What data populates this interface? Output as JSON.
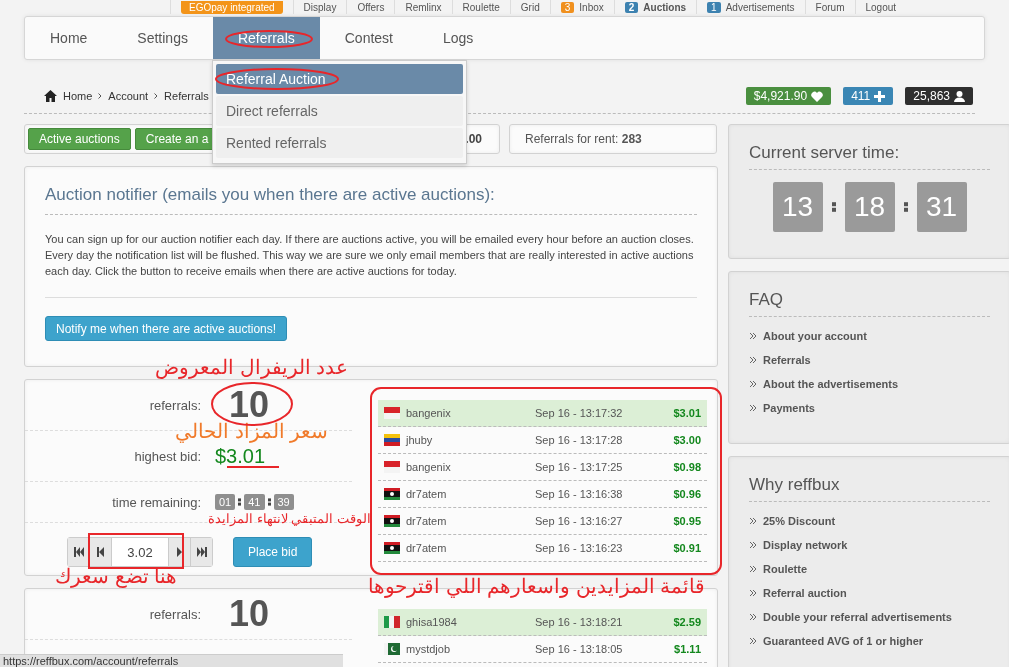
{
  "topbar": [
    {
      "label": "EGOpay integrated",
      "kind": "promo",
      "selected": false
    },
    {
      "label": "Display",
      "kind": "plain",
      "selected": false
    },
    {
      "label": "Offers",
      "kind": "plain",
      "selected": false
    },
    {
      "label": "Remlinx",
      "kind": "plain",
      "selected": false
    },
    {
      "label": "Roulette",
      "kind": "plain",
      "selected": false
    },
    {
      "label": "Grid",
      "kind": "plain",
      "selected": false
    },
    {
      "label": "Inbox",
      "kind": "count",
      "count": "3",
      "color": "#f0901e",
      "selected": false
    },
    {
      "label": "Auctions",
      "kind": "count",
      "count": "2",
      "color": "#3d82b0",
      "selected": true
    },
    {
      "label": "Advertisements",
      "kind": "count",
      "count": "1",
      "color": "#3d82b0",
      "selected": false
    },
    {
      "label": "Forum",
      "kind": "plain",
      "selected": false
    },
    {
      "label": "Logout",
      "kind": "plain",
      "selected": false
    }
  ],
  "tabs": [
    {
      "label": "Home",
      "selected": false
    },
    {
      "label": "Settings",
      "selected": false
    },
    {
      "label": "Referrals",
      "selected": true
    },
    {
      "label": "Contest",
      "selected": false
    },
    {
      "label": "Logs",
      "selected": false
    }
  ],
  "dropdown": [
    {
      "label": "Referral Auction",
      "selected": true
    },
    {
      "label": "Direct referrals",
      "selected": false
    },
    {
      "label": "Rented referrals",
      "selected": false
    }
  ],
  "breadcrumb": [
    "Home",
    "Account",
    "Referrals"
  ],
  "stats": [
    {
      "value": "$4,921.90",
      "kind": "heart",
      "color": "#4a8f3f"
    },
    {
      "value": "411",
      "kind": "plus",
      "color": "#3a86b4"
    },
    {
      "value": "25,863",
      "kind": "user",
      "color": "#2e2e2e"
    }
  ],
  "actions": {
    "buttons": [
      "Active auctions",
      "Create an a"
    ],
    "partial_value": ".00",
    "rent_label": "Referrals for rent:",
    "rent_value": "283"
  },
  "notifier": {
    "title": "Auction notifier (emails you when there are active auctions):",
    "text": "You can sign up for our auction notifier each day. If there are auctions active, you will be emailed every hour before an auction closes. Every day the notification list will be flushed. This way we are sure we only email members that are really interested in active auctions each day. Click the button to receive emails when there are active auctions for today.",
    "button": "Notify me when there are active auctions!"
  },
  "auctions": [
    {
      "referrals_label": "referrals:",
      "referrals": "10",
      "bid_label": "highest bid:",
      "bid": "$3.01",
      "time_label": "time remaining:",
      "time": [
        "01",
        "41",
        "39"
      ],
      "amount": "3.02",
      "place_button": "Place bid",
      "bids": [
        {
          "kind": "id",
          "user": "bangenix",
          "time": "Sep 16 - 13:17:32",
          "amount": "$3.01",
          "leading": true
        },
        {
          "kind": "ve",
          "user": "jhuby",
          "time": "Sep 16 - 13:17:28",
          "amount": "$3.00",
          "leading": false
        },
        {
          "kind": "id",
          "user": "bangenix",
          "time": "Sep 16 - 13:17:25",
          "amount": "$0.98",
          "leading": false
        },
        {
          "kind": "ly",
          "user": "dr7atem",
          "time": "Sep 16 - 13:16:38",
          "amount": "$0.96",
          "leading": false
        },
        {
          "kind": "ly",
          "user": "dr7atem",
          "time": "Sep 16 - 13:16:27",
          "amount": "$0.95",
          "leading": false
        },
        {
          "kind": "ly",
          "user": "dr7atem",
          "time": "Sep 16 - 13:16:23",
          "amount": "$0.91",
          "leading": false
        }
      ]
    },
    {
      "referrals_label": "referrals:",
      "referrals": "10",
      "bids": [
        {
          "kind": "it",
          "user": "ghisa1984",
          "time": "Sep 16 - 13:18:21",
          "amount": "$2.59",
          "leading": true
        },
        {
          "kind": "pk",
          "user": "mystdjob",
          "time": "Sep 16 - 13:18:05",
          "amount": "$1.11",
          "leading": false
        }
      ]
    }
  ],
  "server_time": {
    "title": "Current server time:",
    "digits": [
      "13",
      "18",
      "31"
    ]
  },
  "faq": {
    "title": "FAQ",
    "items": [
      "About your account",
      "Referrals",
      "About the advertisements",
      "Payments"
    ]
  },
  "why": {
    "title": "Why reffbux",
    "items": [
      "25% Discount",
      "Display network",
      "Roulette",
      "Referral auction",
      "Double your referral advertisements",
      "Guaranteed AVG of 1 or higher"
    ]
  },
  "annotations": [
    {
      "text": "عدد الريفرال المعروض",
      "color": "#e8262a"
    },
    {
      "text": "سعر المزاد الحالي",
      "color": "#f07a2a"
    },
    {
      "text": "الوقت المتبقي لانتهاء المزايدة",
      "color": "#e8262a"
    },
    {
      "text": "هنا تضع سعرك",
      "color": "#e8262a"
    },
    {
      "text": "قائمة المزايدين واسعارهم اللي اقترحوها",
      "color": "#e8262a"
    }
  ],
  "status_url": "https://reffbux.com/account/referrals"
}
